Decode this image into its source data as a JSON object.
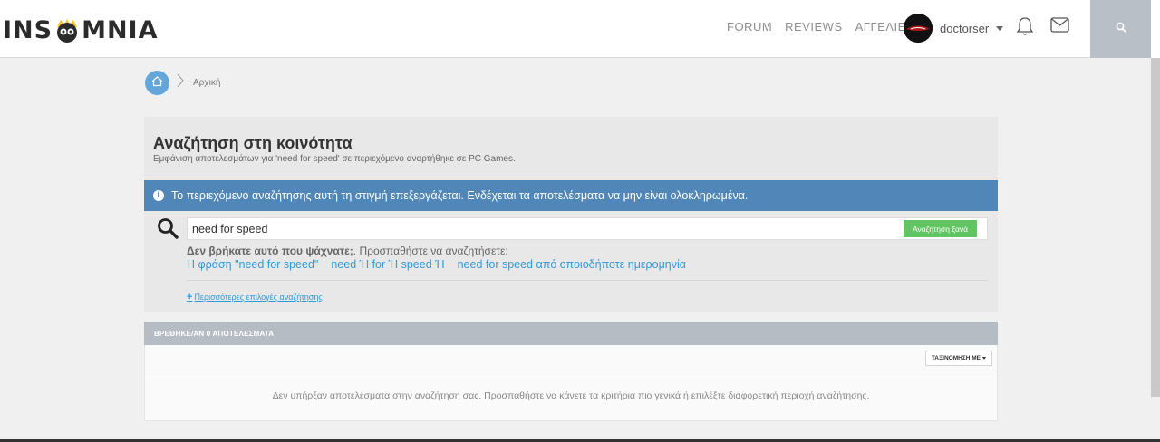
{
  "header": {
    "logo_text_left": "INS",
    "logo_text_right": "MNIA",
    "nav": [
      "FORUM",
      "REVIEWS",
      "ΑΓΓΕΛΙΕΣ"
    ],
    "username": "doctorser"
  },
  "breadcrumb": {
    "current": "Αρχική"
  },
  "search_page": {
    "title": "Αναζήτηση στη κοινότητα",
    "subtitle": "Εμφάνιση αποτελεσμάτων για 'need for speed' σε περιεχόμενο αναρτήθηκε σε PC Games.",
    "alert": "Το περιεχόμενο αναζήτησης αυτή τη στιγμή επεξεργάζεται. Ενδέχεται τα αποτελέσματα να μην είναι ολοκληρωμένα.",
    "query": "need for speed",
    "search_again": "Αναζήτηση ξανά",
    "not_found_bold": "Δεν βρήκατε αυτό που ψάχνατε;",
    "not_found_rest": ". Προσπαθήστε να αναζητήσετε:",
    "suggestions": [
      "Η φράση \"need for speed\"",
      "need Ή for Ή speed Ή",
      "need for speed από οποιοδήποτε ημερομηνία"
    ],
    "more_options": "Περισσότερες επιλογές αναζήτησης"
  },
  "results": {
    "header": "ΒΡΕΘΗΚΕ/ΑΝ 0 ΑΠΟΤΕΛΕΣΜΑΤΑ",
    "sort_label": "ΤΑΞΙΝΟΜΗΣΗ ΜΕ",
    "empty_message": "Δεν υπήρξαν αποτελέσματα στην αναζήτηση σας. Προσπαθήστε να κάνετε τα κριτήρια πιο γενικά ή επιλέξτε διαφορετική περιοχή αναζήτησης."
  },
  "colors": {
    "alert_bg": "#5087b8",
    "button_green": "#62c462",
    "link_blue": "#2f9ad9",
    "home_blue": "#62a6da",
    "results_header_bg": "#b6bcc4"
  }
}
